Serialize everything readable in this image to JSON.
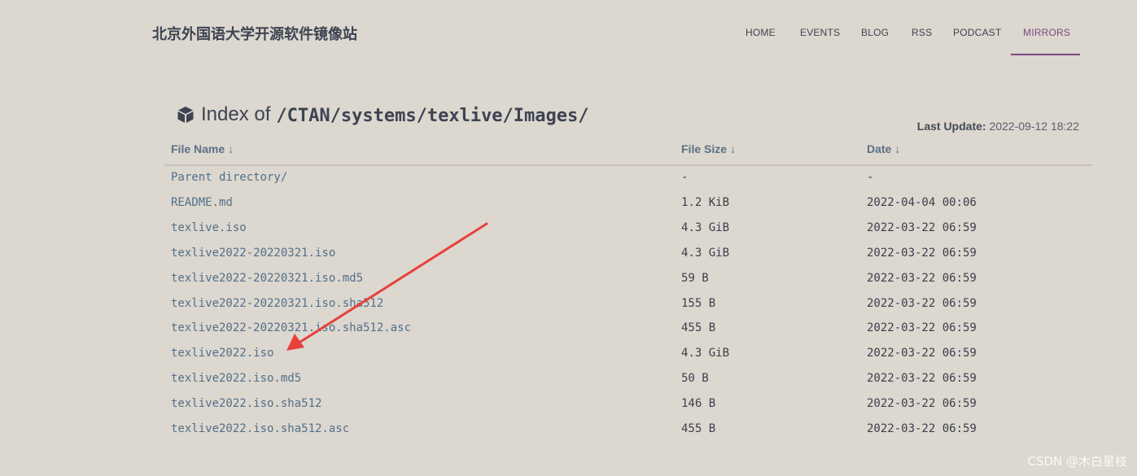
{
  "site": {
    "title": "北京外国语大学开源软件镜像站"
  },
  "nav": {
    "items": [
      "HOME",
      "EVENTS",
      "BLOG",
      "RSS",
      "PODCAST",
      "MIRRORS"
    ],
    "active": "MIRRORS",
    "accent_color": "#7b4a82"
  },
  "heading": {
    "icon": "box-icon",
    "prefix": "Index of",
    "path": "/CTAN/systems/texlive/Images/"
  },
  "last_update": {
    "label": "Last Update:",
    "value": "2022-09-12 18:22"
  },
  "table": {
    "columns": [
      {
        "label": "File Name",
        "sort_icon": "↓"
      },
      {
        "label": "File Size",
        "sort_icon": "↓"
      },
      {
        "label": "Date",
        "sort_icon": "↓"
      }
    ],
    "rows": [
      {
        "name": "Parent directory/",
        "size": "-",
        "date": "-"
      },
      {
        "name": "README.md",
        "size": "1.2 KiB",
        "date": "2022-04-04 00:06"
      },
      {
        "name": "texlive.iso",
        "size": "4.3 GiB",
        "date": "2022-03-22 06:59"
      },
      {
        "name": "texlive2022-20220321.iso",
        "size": "4.3 GiB",
        "date": "2022-03-22 06:59"
      },
      {
        "name": "texlive2022-20220321.iso.md5",
        "size": "59 B",
        "date": "2022-03-22 06:59"
      },
      {
        "name": "texlive2022-20220321.iso.sha512",
        "size": "155 B",
        "date": "2022-03-22 06:59"
      },
      {
        "name": "texlive2022-20220321.iso.sha512.asc",
        "size": "455 B",
        "date": "2022-03-22 06:59"
      },
      {
        "name": "texlive2022.iso",
        "size": "4.3 GiB",
        "date": "2022-03-22 06:59"
      },
      {
        "name": "texlive2022.iso.md5",
        "size": "50 B",
        "date": "2022-03-22 06:59"
      },
      {
        "name": "texlive2022.iso.sha512",
        "size": "146 B",
        "date": "2022-03-22 06:59"
      },
      {
        "name": "texlive2022.iso.sha512.asc",
        "size": "455 B",
        "date": "2022-03-22 06:59"
      }
    ]
  },
  "annotation": {
    "arrow_color": "#e8403b"
  },
  "watermark": "CSDN @木白星枝"
}
